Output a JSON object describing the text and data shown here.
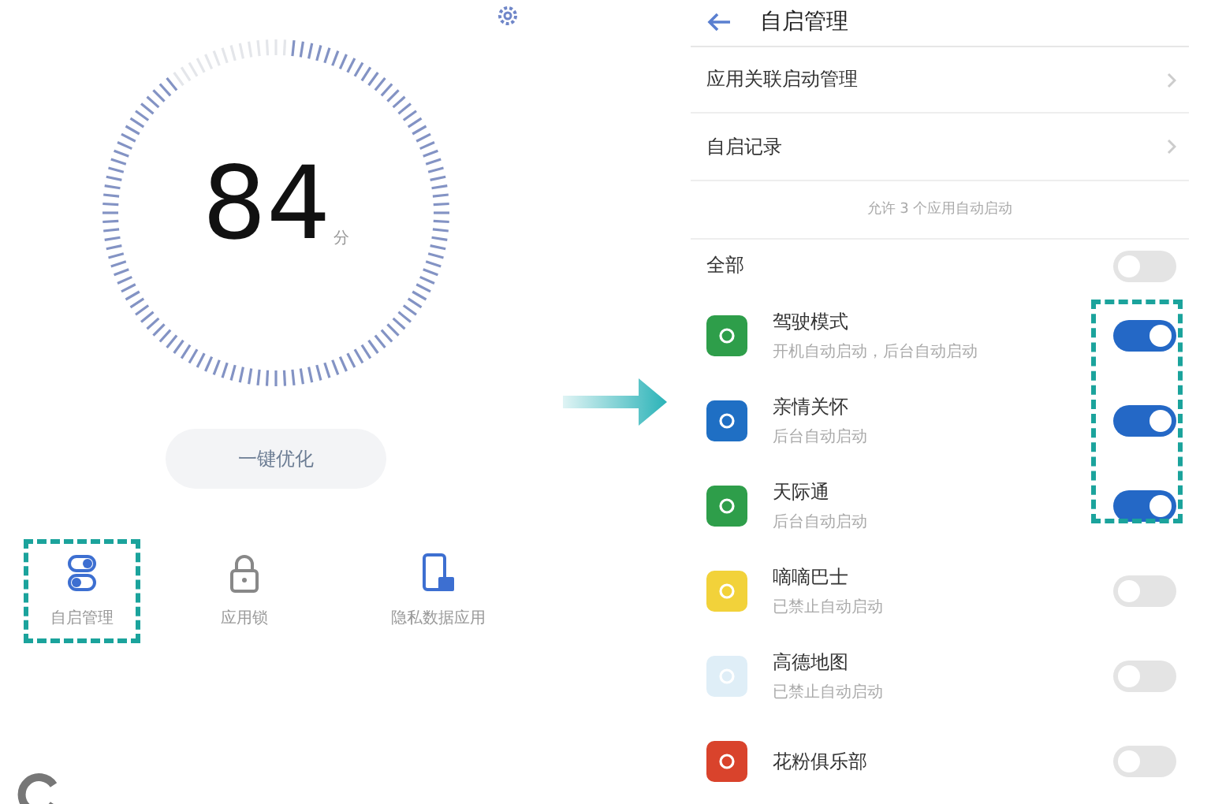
{
  "left_screen": {
    "score": "84",
    "score_unit": "分",
    "optimize_button": "一键优化",
    "tools": [
      {
        "label": "自启管理",
        "highlighted": true,
        "kind": "startup"
      },
      {
        "label": "应用锁",
        "highlighted": false,
        "kind": "lock"
      },
      {
        "label": "隐私数据应用",
        "highlighted": false,
        "kind": "phone"
      }
    ]
  },
  "right_screen": {
    "title": "自启管理",
    "menu": [
      {
        "label": "应用关联启动管理"
      },
      {
        "label": "自启记录"
      }
    ],
    "note": "允许 3 个应用自动启动",
    "all_toggle": {
      "label": "全部",
      "on": false
    },
    "apps": [
      {
        "name": "驾驶模式",
        "status": "开机自动启动，后台自动启动",
        "on": true,
        "color": "#2e9e4a"
      },
      {
        "name": "亲情关怀",
        "status": "后台自动启动",
        "on": true,
        "color": "#1f6fc4"
      },
      {
        "name": "天际通",
        "status": "后台自动启动",
        "on": true,
        "color": "#2e9e4a"
      },
      {
        "name": "嘀嘀巴士",
        "status": "已禁止自动启动",
        "on": false,
        "color": "#f2d23a"
      },
      {
        "name": "高德地图",
        "status": "已禁止自动启动",
        "on": false,
        "color": "#dfeef7"
      },
      {
        "name": "花粉俱乐部",
        "on": false,
        "color": "#d9432c"
      }
    ]
  }
}
